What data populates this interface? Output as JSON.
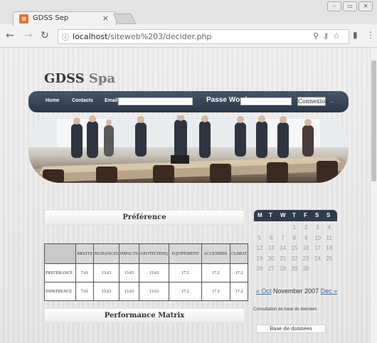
{
  "browser": {
    "tab_title": "GDSS Sep",
    "tab_close": "×",
    "favicon": "⊠",
    "url_host": "localhost",
    "url_path": "/siteweb%203/decider.php",
    "win_minimize": "–",
    "win_restore": "▭",
    "win_close": "✕"
  },
  "site": {
    "logo_main": "GDSS",
    "logo_accent": "Spa",
    "menu": {
      "home": "Home",
      "contacts": "Contacts",
      "email_label": "Email",
      "email_value": "",
      "password_label": "Passe Word",
      "password_value": "",
      "connect": "Connexion",
      "dot": "."
    }
  },
  "preference": {
    "title": "Préférence",
    "headers": [
      "",
      "BRUITS",
      "NUISANCES",
      "IMPACTS",
      "GEOTECHNIQ",
      "EQUIPEMENT",
      "ACCESSIBIL",
      "CLIMAT"
    ],
    "rows": [
      [
        "PREFERANCE",
        "7.61",
        "13.63",
        "13.63",
        "13.63",
        "17.2",
        "17.2",
        "17.2"
      ],
      [
        "INDEFRENCE",
        "7.61",
        "13.63",
        "13.63",
        "13.63",
        "17.2",
        "17.2",
        "17.2"
      ]
    ]
  },
  "performance": {
    "title": "Performance Matrix"
  },
  "calendar": {
    "days": [
      "M",
      "T",
      "W",
      "T",
      "F",
      "S",
      "S"
    ],
    "weeks": [
      [
        "",
        "",
        "",
        "1",
        "2",
        "3",
        "4"
      ],
      [
        "5",
        "6",
        "7",
        "8",
        "9",
        "10",
        "11"
      ],
      [
        "12",
        "13",
        "14",
        "15",
        "16",
        "17",
        "18"
      ],
      [
        "19",
        "20",
        "21",
        "22",
        "23",
        "24",
        "25"
      ],
      [
        "26",
        "27",
        "28",
        "29",
        "30",
        "",
        ""
      ]
    ],
    "prev": "« Oct",
    "month": "November 2007",
    "next": "Dec »"
  },
  "database": {
    "caption": "Consultation de base de données",
    "button": "Base de données"
  }
}
